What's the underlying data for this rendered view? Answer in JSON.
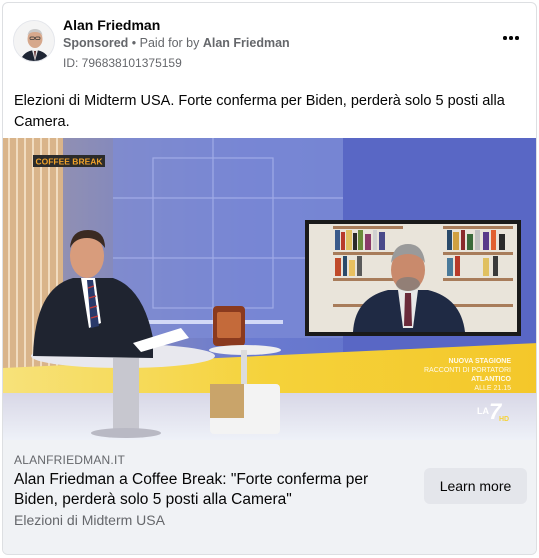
{
  "post": {
    "page_name": "Alan Friedman",
    "sponsored_label": "Sponsored",
    "separator": " • ",
    "paid_for_label": "Paid for by ",
    "payer": "Alan Friedman",
    "ad_id": "ID: 796838101375159",
    "more_icon": "ellipsis-icon",
    "text": "Elezioni di Midterm USA. Forte conferma per Biden, perderà solo 5 posti alla Camera."
  },
  "media": {
    "show_banner": "COFFEE BREAK",
    "ticker_line1": "NUOVA STAGIONE",
    "ticker_line2": "RACCONTI DI PORTATORI",
    "ticker_line3": "ATLANTICO",
    "ticker_line4": "ALLE 21.15",
    "channel_logo": "LA 7 HD",
    "channel_logo_prefix": "LA",
    "channel_logo_number": "7",
    "channel_logo_suffix": "HD"
  },
  "link": {
    "domain": "ALANFRIEDMAN.IT",
    "title": "Alan Friedman a Coffee Break: \"Forte conferma per Biden, perderà solo 5 posti alla Camera\"",
    "description": "Elezioni di Midterm USA",
    "cta_label": "Learn more"
  },
  "colors": {
    "studio_blue": "#6c78c9",
    "studio_yellow": "#f5d23a",
    "banner_bg": "#2b2b2b",
    "banner_text": "#f0a22a",
    "footer_bg": "#f0f2f5",
    "button_bg": "#e4e6eb"
  }
}
